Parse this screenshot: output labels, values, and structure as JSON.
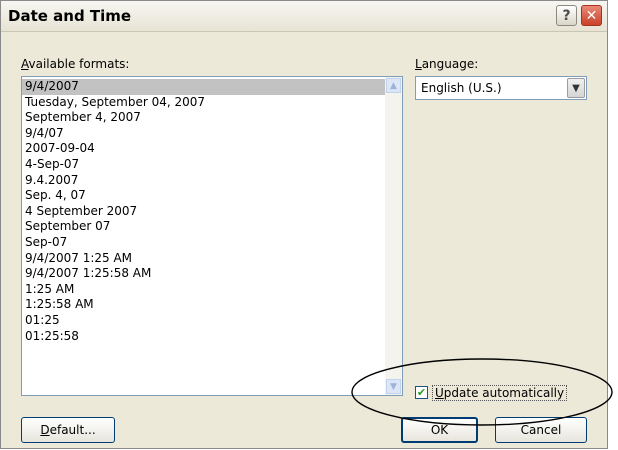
{
  "window": {
    "title": "Date and Time"
  },
  "titlebar": {
    "help_glyph": "?",
    "close_glyph": "✕"
  },
  "formats": {
    "label_accel": "A",
    "label_rest": "vailable formats:",
    "items": [
      "9/4/2007",
      "Tuesday, September 04, 2007",
      "September 4, 2007",
      "9/4/07",
      "2007-09-04",
      "4-Sep-07",
      "9.4.2007",
      "Sep. 4, 07",
      "4 September 2007",
      "September 07",
      "Sep-07",
      "9/4/2007 1:25 AM",
      "9/4/2007 1:25:58 AM",
      "1:25 AM",
      "1:25:58 AM",
      "01:25",
      "01:25:58"
    ],
    "selected_index": 0
  },
  "language": {
    "label_accel": "L",
    "label_rest": "anguage:",
    "value": "English (U.S.)"
  },
  "update_auto": {
    "checked": true,
    "label_accel": "U",
    "label_rest": "pdate automatically"
  },
  "buttons": {
    "default_accel": "D",
    "default_rest": "efault...",
    "ok": "OK",
    "cancel": "Cancel"
  },
  "icons": {
    "help": "help-icon",
    "close": "close-icon",
    "scroll_up": "scroll-up-arrow-icon",
    "scroll_down": "scroll-down-arrow-icon",
    "dropdown": "chevron-down-icon",
    "check": "checkmark-icon"
  },
  "colors": {
    "dialog_bg": "#ece9d8",
    "selection": "#c2c2c2",
    "input_border": "#7f9db9",
    "button_border": "#003c74",
    "close_red": "#c9412a",
    "check_green": "#21a121"
  }
}
